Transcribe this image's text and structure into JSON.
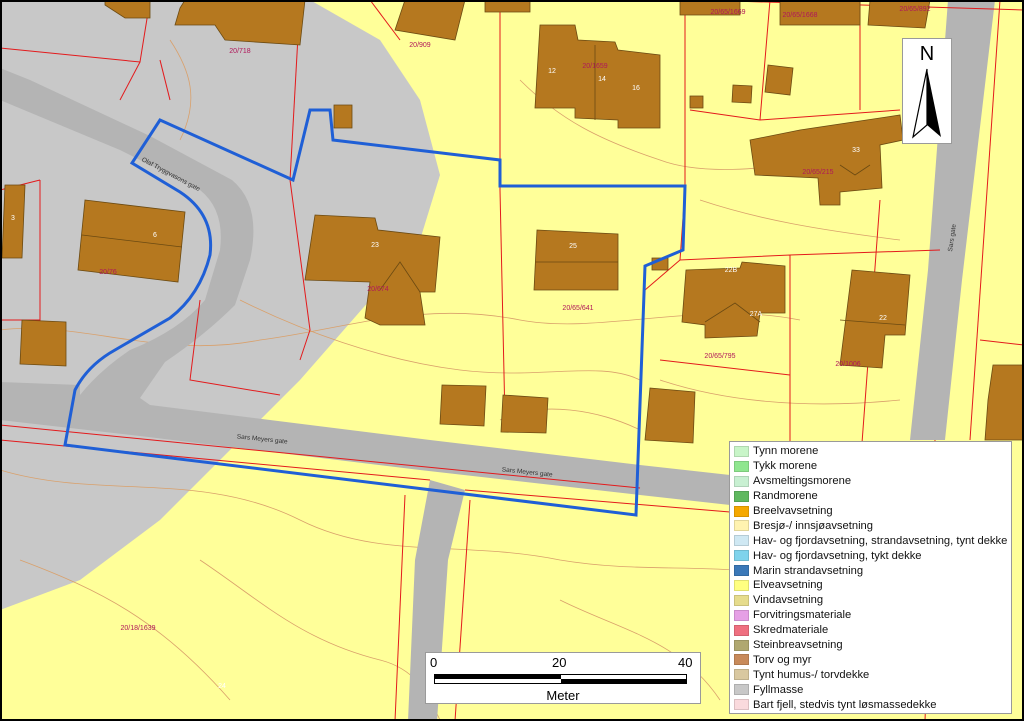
{
  "map": {
    "colors": {
      "background_deposit": "#ffff99",
      "fill_deposit": "#c8c8c8",
      "road": "#b4b4b4",
      "building": "#b5781f",
      "parcel_line": "#e31a1c",
      "contour_line": "#d9a06b",
      "study_boundary": "#1f5fd6"
    },
    "parcel_labels": [
      "20/718",
      "20/909",
      "20/1659",
      "20/65/1669",
      "20/65/1668",
      "20/65/892",
      "20/76",
      "20/674",
      "20/65/641",
      "20/65/215",
      "20/65/795",
      "20/1006",
      "20/18/1639"
    ],
    "house_numbers": [
      "12",
      "14",
      "16",
      "33",
      "3",
      "6",
      "23",
      "25",
      "22B",
      "27A",
      "22",
      "24"
    ],
    "street_labels": [
      "Sars Meyers gate",
      "Sars Meyers gate",
      "Olaf Tryggvasons gate",
      "Sars gate"
    ]
  },
  "north_arrow": {
    "letter": "N"
  },
  "scale_bar": {
    "ticks": [
      "0",
      "20",
      "40"
    ],
    "unit": "Meter"
  },
  "legend": {
    "items": [
      {
        "label": "Tynn morene",
        "color": "#c8f5c8"
      },
      {
        "label": "Tykk morene",
        "color": "#8fe68f"
      },
      {
        "label": "Avsmeltingsmorene",
        "color": "#c8f0d2"
      },
      {
        "label": "Randmorene",
        "color": "#5fb85f"
      },
      {
        "label": "Breelvavsetning",
        "color": "#f5a800"
      },
      {
        "label": "Bresjø-/ innsjøavsetning",
        "color": "#fff3b0"
      },
      {
        "label": "Hav- og fjordavsetning, strandavsetning, tynt dekke",
        "color": "#cfe8f3"
      },
      {
        "label": "Hav- og fjordavsetning, tykt dekke",
        "color": "#7fd3ec"
      },
      {
        "label": "Marin strandavsetning",
        "color": "#3a78b8"
      },
      {
        "label": "Elveavsetning",
        "color": "#ffff80"
      },
      {
        "label": "Vindavsetning",
        "color": "#e6dc8c"
      },
      {
        "label": "Forvitringsmateriale",
        "color": "#e6a0e6"
      },
      {
        "label": "Skredmateriale",
        "color": "#ef6f80"
      },
      {
        "label": "Steinbreavsetning",
        "color": "#b0a870"
      },
      {
        "label": "Torv og myr",
        "color": "#c88a5a"
      },
      {
        "label": "Tynt humus-/ torvdekke",
        "color": "#d9c8a0"
      },
      {
        "label": "Fyllmasse",
        "color": "#c8c8c8"
      },
      {
        "label": "Bart fjell, stedvis tynt løsmassedekke",
        "color": "#fadadd"
      }
    ]
  }
}
